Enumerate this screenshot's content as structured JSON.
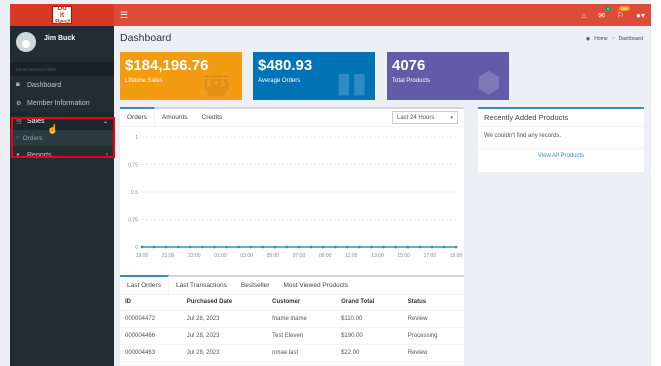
{
  "logo": {
    "line1": "Do it",
    "line2": "Best"
  },
  "header": {
    "menu_icon": "hamburger-icon",
    "icons": [
      {
        "name": "home-icon",
        "glyph": "⌂"
      },
      {
        "name": "mail-icon",
        "glyph": "✉",
        "badge": "4"
      },
      {
        "name": "bell-icon",
        "glyph": "⚐",
        "badge": "99+"
      },
      {
        "name": "user-icon",
        "glyph": "▴"
      }
    ]
  },
  "sidebar": {
    "user_name": "Jim Buck",
    "nav_header": "MAIN NAVIGATION",
    "items": [
      {
        "label": "Dashboard"
      },
      {
        "label": "Member Information"
      },
      {
        "label": "Sales"
      },
      {
        "label": "Orders"
      },
      {
        "label": "Reports"
      }
    ]
  },
  "page": {
    "title": "Dashboard",
    "breadcrumb_home": "Home",
    "breadcrumb_current": "Dashboard"
  },
  "stats": [
    {
      "value": "$184,196.76",
      "label": "Lifetime Sales",
      "color": "#f39c12"
    },
    {
      "value": "$480.93",
      "label": "Average Orders",
      "color": "#0073b7"
    },
    {
      "value": "4076",
      "label": "Total Products",
      "color": "#605ca8"
    }
  ],
  "chart_tabs": [
    "Orders",
    "Amounts",
    "Credits"
  ],
  "chart_select": "Last 24 Hours",
  "chart_data": {
    "type": "line",
    "x": [
      "19:00",
      "21:00",
      "23:00",
      "01:00",
      "03:00",
      "05:00",
      "07:00",
      "09:00",
      "11:00",
      "13:00",
      "15:00",
      "17:00",
      "19:00"
    ],
    "series": [
      {
        "values": [
          0,
          0,
          0,
          0,
          0,
          0,
          0,
          0,
          0,
          0,
          0,
          0,
          0,
          0,
          0,
          0,
          0,
          0,
          0,
          0,
          0,
          0,
          0,
          0,
          0,
          0,
          0
        ]
      }
    ],
    "yticks": [
      "1",
      "0.75",
      "0.5",
      "0.25",
      "0"
    ],
    "ylim": [
      0,
      1
    ],
    "grid": true
  },
  "order_tabs": [
    "Last Orders",
    "Last Transactions",
    "Bestseller",
    "Most Viewed Products"
  ],
  "orders": {
    "headers": [
      "ID",
      "Purchased Date",
      "Customer",
      "Grand Total",
      "Status"
    ],
    "rows": [
      [
        "000004472",
        "Jul 28, 2023",
        "fname lname",
        "$110.00",
        "Review"
      ],
      [
        "000004466",
        "Jul 28, 2023",
        "Test Eleven",
        "$190.00",
        "Processing"
      ],
      [
        "000004463",
        "Jul 28, 2023",
        "nmae last",
        "$22.00",
        "Review"
      ]
    ]
  },
  "recent_products": {
    "title": "Recently Added Products",
    "empty_text": "We couldn't find any records.",
    "link": "View All Products"
  }
}
